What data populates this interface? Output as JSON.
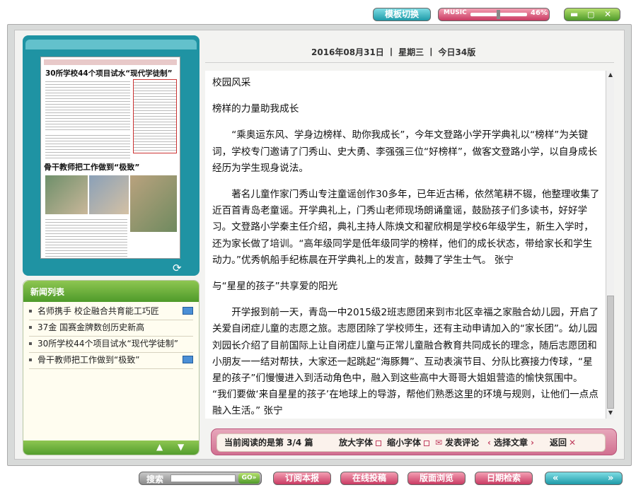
{
  "top": {
    "template_switch": "模板切换",
    "music_label": "MUSIC",
    "music_volume": "46%",
    "music_fraction": 0.46
  },
  "date_line": "2016年08月31日 丨 星期三 丨 今日34版",
  "news_list": {
    "title": "新闻列表",
    "items": [
      {
        "text": "名师携手 校企融合共育能工巧匠",
        "has_image": true
      },
      {
        "text": "37金 国赛金牌数创历史新高",
        "has_image": false
      },
      {
        "text": "30所学校44个项目试水“现代学徒制”",
        "has_image": false
      },
      {
        "text": "骨干教师把工作做到“极致”",
        "has_image": true
      }
    ]
  },
  "paper": {
    "banner": "30所学校44个项目试水“现代学徒制”",
    "headline": "骨干教师把工作做到“极致”"
  },
  "article": {
    "section": "校园风采",
    "title1": "榜样的力量助我成长",
    "p1": "“乘奥运东风、学身边榜样、助你我成长”，今年文登路小学开学典礼以“榜样”为关键词，学校专门邀请了门秀山、史大勇、李强强三位“好榜样”，做客文登路小学，以自身成长经历为学生现身说法。",
    "p2": "著名儿童作家门秀山专注童谣创作30多年，已年近古稀，依然笔耕不辍，他整理收集了近百首青岛老童谣。开学典礼上，门秀山老师现场朗诵童谣，鼓励孩子们多读书，好好学习。文登路小学秦主任介绍，典礼主持人陈焕文和翟欣桐是学校6年级学生，新生入学时，还为家长做了培训。“高年级同学是低年级同学的榜样，他们的成长状态，带给家长和学生动力。”优秀帆船手纪栋晨在开学典礼上的发言，鼓舞了学生士气。 张宁",
    "title2": "与“星星的孩子”共享爱的阳光",
    "p3": "开学报到前一天，青岛一中2015级2班志愿团来到市北区幸福之家融合幼儿园，开启了关爱自闭症儿童的志愿之旅。志愿团除了学校师生，还有主动申请加入的“家长团”。幼儿园刘园长介绍了目前国际上让自闭症儿童与正常儿童融合教育共同成长的理念，随后志愿团和小朋友一一结对帮扶，大家还一起跳起“海豚舞”、互动表演节目、分队比赛接力传球，“星星的孩子”们慢慢进入到活动角色中，融入到这些高中大哥哥大姐姐营造的愉快氛围中。 “我们要做‘来自星星的孩子’在地球上的导游，帮他们熟悉这里的环境与规则，让他们一点点融入生活。” 张宁"
  },
  "bottom_bar": {
    "reading": "当前阅读的是第  3/4  篇",
    "enlarge": "放大字体",
    "shrink": "缩小字体",
    "comment": "发表评论",
    "select": "选择文章",
    "back": "返回"
  },
  "footer": {
    "search_label": "搜索",
    "go": "GO",
    "subscribe": "订阅本报",
    "submit": "在线投稿",
    "browse": "版面浏览",
    "date_search": "日期检索"
  },
  "colors": {
    "teal": "#1e9aa8",
    "pink": "#c93a62",
    "green": "#4e9a2a"
  }
}
